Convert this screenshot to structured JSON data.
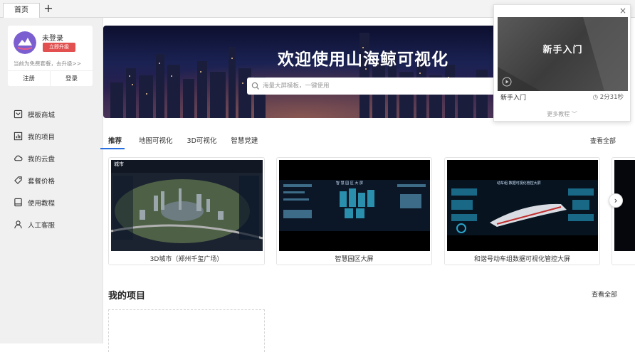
{
  "tabs": {
    "home": "首页",
    "add": "+"
  },
  "user": {
    "name": "未登录",
    "upgrade": "立即升级",
    "free_note": "当前为免费套餐，去升级>>",
    "register": "注册",
    "login": "登录"
  },
  "nav": {
    "items": [
      {
        "label": "模板商城",
        "icon": "template-store-icon"
      },
      {
        "label": "我的项目",
        "icon": "chart-icon"
      },
      {
        "label": "我的云盘",
        "icon": "cloud-icon"
      },
      {
        "label": "套餐价格",
        "icon": "price-tag-icon"
      },
      {
        "label": "使用教程",
        "icon": "book-icon"
      },
      {
        "label": "人工客服",
        "icon": "user-icon"
      }
    ]
  },
  "banner": {
    "title": "欢迎使用山海鲸可视化",
    "search_placeholder": "海量大屏模板，一键使用"
  },
  "categories": {
    "tabs": [
      "推荐",
      "地图可视化",
      "3D可视化",
      "智慧党建"
    ],
    "see_all": "查看全部"
  },
  "templates": [
    {
      "title": "3D城市（郑州千玺广场）",
      "thumb_label": "城市"
    },
    {
      "title": "智慧园区大屏",
      "thumb_label": "智 慧 园 区 大 屏"
    },
    {
      "title": "和谐号动车组数据可视化管控大屏",
      "thumb_label": "动车组·数据可视化管控大屏"
    }
  ],
  "projects": {
    "title": "我的项目",
    "see_all": "查看全部"
  },
  "popup": {
    "close": "×",
    "video_title": "新手入门",
    "name": "新手入门",
    "duration": "2分31秒",
    "more": "更多教程"
  }
}
